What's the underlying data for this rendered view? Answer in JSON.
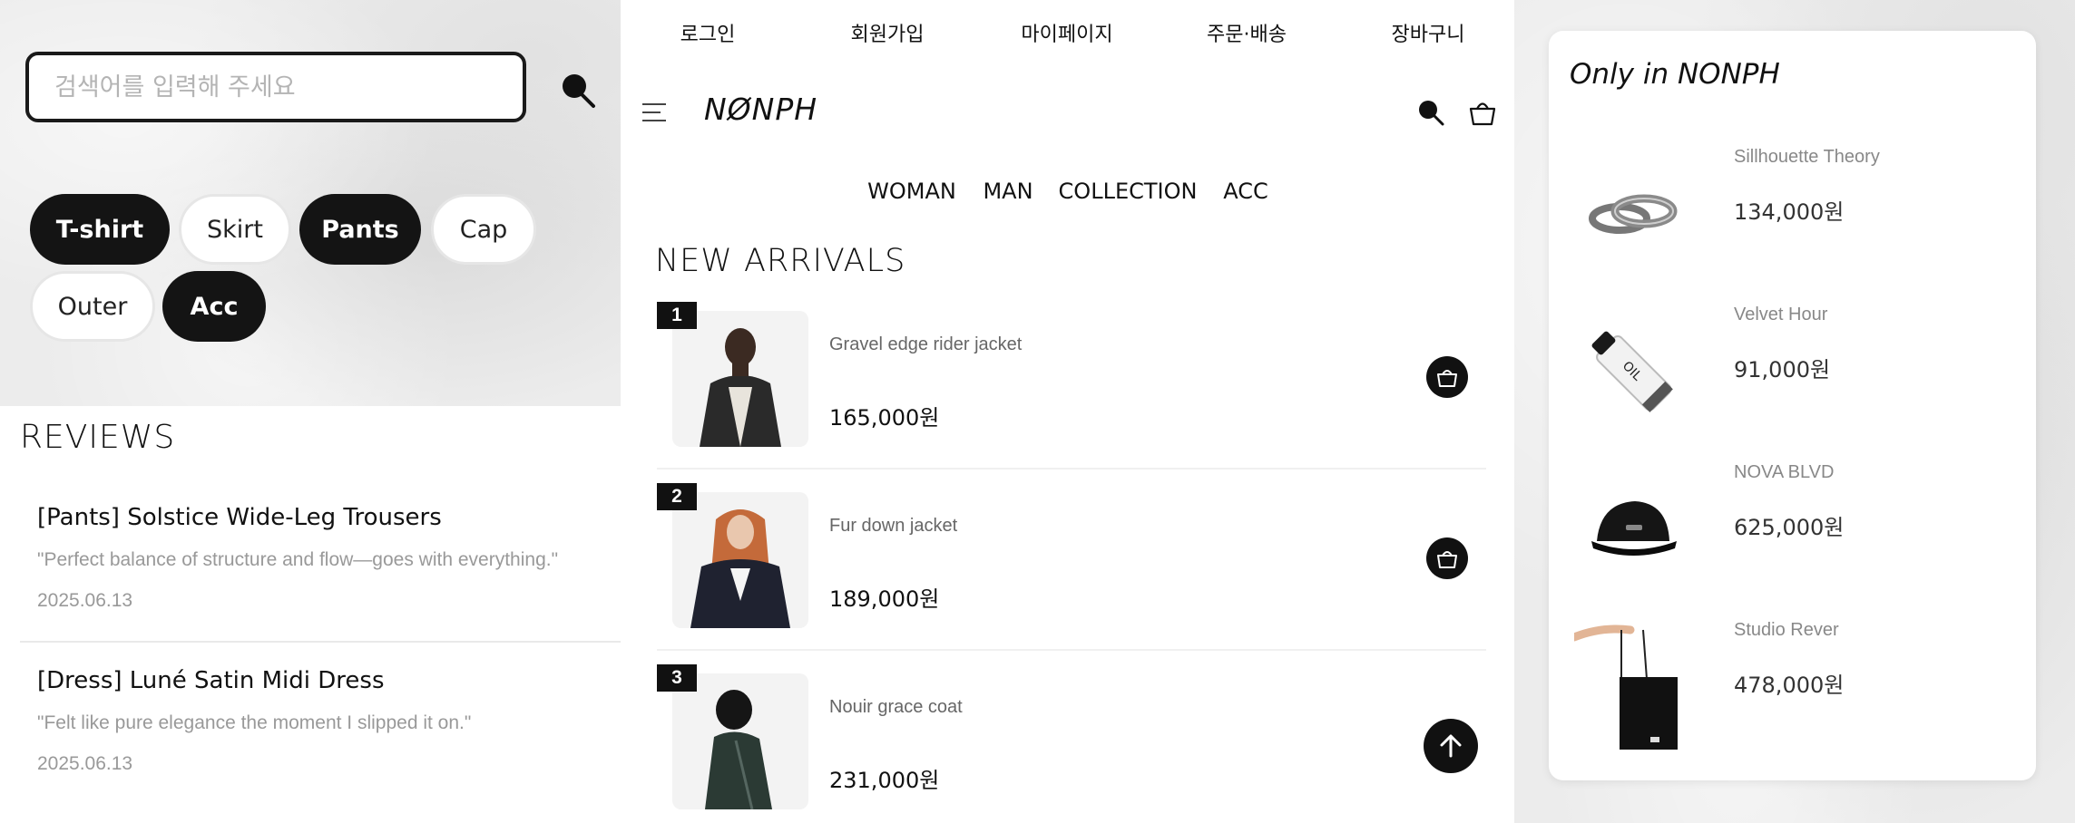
{
  "search": {
    "placeholder": "검색어를 입력해 주세요"
  },
  "categories": [
    "T-shirt",
    "Skirt",
    "Pants",
    "Cap",
    "Outer",
    "Acc"
  ],
  "reviews": {
    "title": "REVIEWS",
    "items": [
      {
        "title": "[Pants] Solstice Wide-Leg Trousers",
        "quote": "\"Perfect balance of structure and flow—goes with everything.\"",
        "date": "2025.06.13"
      },
      {
        "title": "[Dress] Luné Satin Midi Dress",
        "quote": "\"Felt like pure elegance the moment I slipped it on.\"",
        "date": "2025.06.13"
      }
    ]
  },
  "topnav": [
    "로그인",
    "회원가입",
    "마이페이지",
    "주문·배송",
    "장바구니"
  ],
  "brand": {
    "logo": "NØNPH"
  },
  "catnav": [
    "WOMAN",
    "MAN",
    "COLLECTION",
    "ACC"
  ],
  "arrivals": {
    "title": "NEW ARRIVALS",
    "items": [
      {
        "rank": "1",
        "name": "Gravel edge rider jacket",
        "price": "165,000원"
      },
      {
        "rank": "2",
        "name": "Fur down jacket",
        "price": "189,000원"
      },
      {
        "rank": "3",
        "name": "Nouir grace coat",
        "price": "231,000원"
      }
    ]
  },
  "featured": {
    "title": "Only in NONPH",
    "items": [
      {
        "name": "Sillhouette Theory",
        "price": "134,000원",
        "icon": "rings-image"
      },
      {
        "name": "Velvet Hour",
        "price": "91,000원",
        "icon": "oil-bottle-image"
      },
      {
        "name": "NOVA BLVD",
        "price": "625,000원",
        "icon": "cap-image"
      },
      {
        "name": "Studio Rever",
        "price": "478,000원",
        "icon": "tote-bag-image"
      }
    ]
  },
  "colors": {
    "dark": "#141414",
    "chip_border": "#e6e6e6",
    "muted_text": "#999999"
  }
}
